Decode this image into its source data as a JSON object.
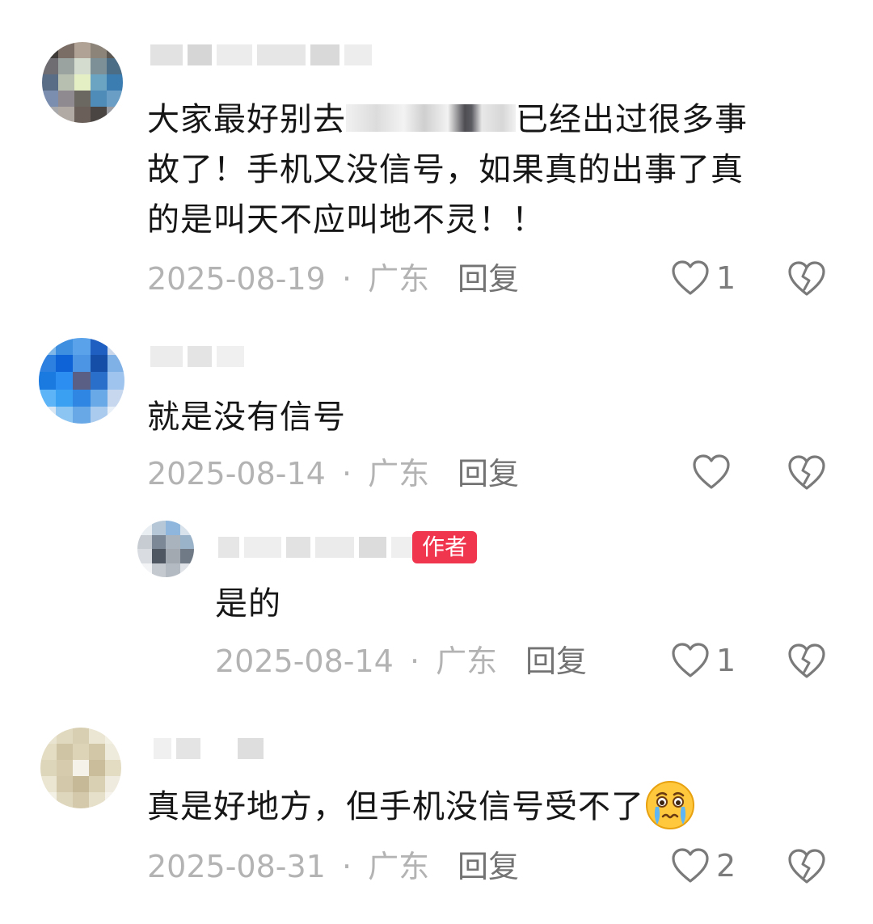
{
  "comments": [
    {
      "text_before": "大家最好别去",
      "text_after": "已经出过很多事",
      "line2": "故了！手机又没信号，如果真的出事了真",
      "line3": "的是叫天不应叫地不灵！！",
      "date": "2025-08-19",
      "location": "广东",
      "reply_label": "回复",
      "likes": "1",
      "icons": {
        "like": "heart-icon",
        "dislike": "broken-heart-icon"
      }
    },
    {
      "text": "就是没有信号",
      "date": "2025-08-14",
      "location": "广东",
      "reply_label": "回复",
      "likes": "",
      "reply": {
        "badge": "作者",
        "text": "是的",
        "date": "2025-08-14",
        "location": "广东",
        "reply_label": "回复",
        "likes": "1"
      }
    },
    {
      "text": "真是好地方，但手机没信号受不了",
      "emoji": "crying-face-emoji",
      "date": "2025-08-31",
      "location": "广东",
      "reply_label": "回复",
      "likes": "2"
    }
  ],
  "separator": "·",
  "colors": {
    "author_badge": "#f0354f",
    "meta_text": "#b3b3b3",
    "reply_text": "#737373",
    "body_text": "#161616"
  }
}
